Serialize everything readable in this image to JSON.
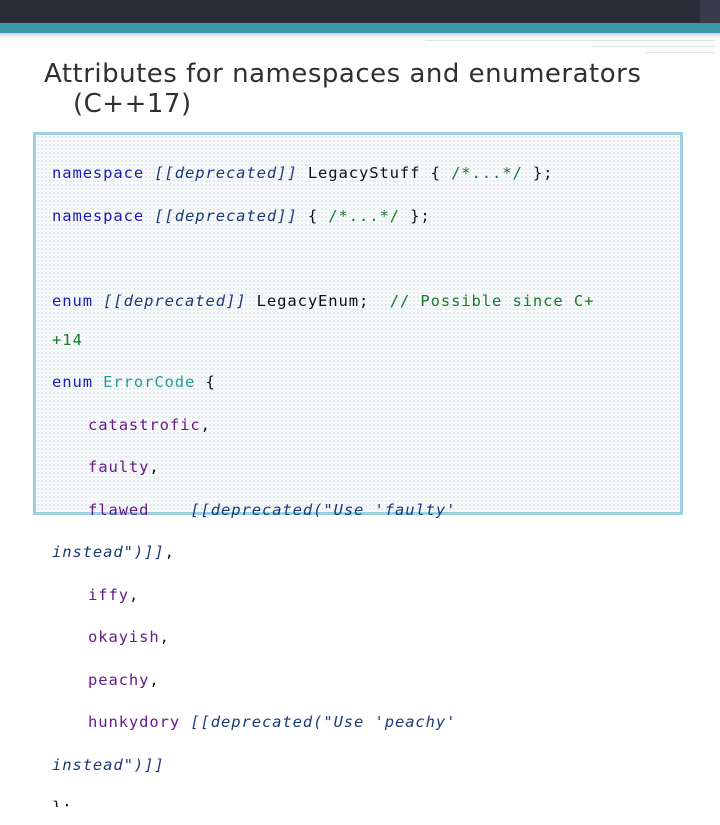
{
  "slide": {
    "title_line1": "Attributes for namespaces and enumerators",
    "title_line2": "(C++17)"
  },
  "code": {
    "l1": {
      "kw": "namespace",
      "attr": "[[deprecated]]",
      "plain": "LegacyStuff {",
      "cm": "/*...*/",
      "end": "};"
    },
    "l2": {
      "kw": "namespace",
      "attr": "[[deprecated]]",
      "plain": "{",
      "cm": "/*...*/",
      "end": "};"
    },
    "l3": {
      "kw": "enum",
      "attr": "[[deprecated]]",
      "plain": "LegacyEnum;",
      "cm": "// Possible since C+"
    },
    "l3b": {
      "cm": "+14"
    },
    "l4": {
      "kw": "enum",
      "ty": "ErrorCode",
      "plain": "{"
    },
    "e1": {
      "name": "catastrofic",
      "punct": ","
    },
    "e2": {
      "name": "faulty",
      "punct": ","
    },
    "e3": {
      "name": "flawed",
      "attr": "[[deprecated(\"Use 'faulty'"
    },
    "e3b": {
      "attr": "instead\")]]",
      "punct": ","
    },
    "e4": {
      "name": "iffy",
      "punct": ","
    },
    "e5": {
      "name": "okayish",
      "punct": ","
    },
    "e6": {
      "name": "peachy",
      "punct": ","
    },
    "e7": {
      "name": "hunkydory",
      "attr": "[[deprecated(\"Use 'peachy'"
    },
    "e7b": {
      "attr": "instead\")]]"
    },
    "close": "};"
  },
  "colors": {
    "keyword": "#1b1bb4",
    "attribute": "#1a3a78",
    "comment": "#1a7a2a",
    "type": "#2a9a9a",
    "enumerator": "#6a1a8a",
    "accent_bar": "#3a9aa8",
    "top_bar": "#2b2b38",
    "box_border": "#9dd0e0"
  }
}
